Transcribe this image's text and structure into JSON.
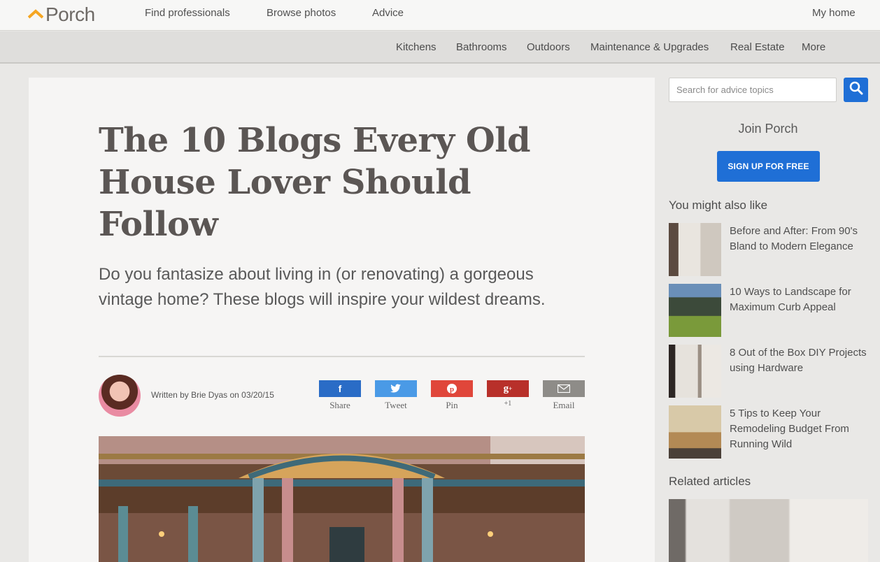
{
  "header": {
    "logo_text": "Porch",
    "nav": [
      "Find professionals",
      "Browse photos",
      "Advice"
    ],
    "my_home": "My home"
  },
  "categories": [
    "Kitchens",
    "Bathrooms",
    "Outdoors",
    "Maintenance & Upgrades",
    "Real Estate",
    "More"
  ],
  "article": {
    "title": "The 10 Blogs Every Old House Lover Should Follow",
    "subtitle": "Do you fantasize about living in (or renovating) a gorgeous vintage home? These blogs will inspire your wildest dreams.",
    "byline": "Written by Brie Dyas on 03/20/15",
    "share": [
      {
        "label": "Share",
        "icon": "facebook-icon",
        "glyph": "f",
        "color": "#2a6cc6"
      },
      {
        "label": "Tweet",
        "icon": "twitter-icon",
        "glyph": "t",
        "color": "#4a9ae6"
      },
      {
        "label": "Pin",
        "icon": "pinterest-icon",
        "glyph": "p",
        "color": "#e0463a"
      },
      {
        "label": "+1",
        "icon": "google-plus-icon",
        "glyph": "g+",
        "color": "#b8302a"
      },
      {
        "label": "Email",
        "icon": "email-icon",
        "glyph": "✉",
        "color": "#8e8c88"
      }
    ]
  },
  "sidebar": {
    "search_placeholder": "Search for advice topics",
    "join_title": "Join Porch",
    "signup_label": "SIGN UP FOR FREE",
    "might_like_heading": "You might also like",
    "recommendations": [
      "Before and After: From 90's Bland to Modern Elegance",
      "10 Ways to Landscape for Maximum Curb Appeal",
      "8 Out of the Box DIY Projects using Hardware",
      "5 Tips to Keep Your Remodeling Budget From Running Wild"
    ],
    "related_heading": "Related articles"
  },
  "colors": {
    "accent_blue": "#1f6fd6",
    "logo_orange": "#f5a623"
  }
}
